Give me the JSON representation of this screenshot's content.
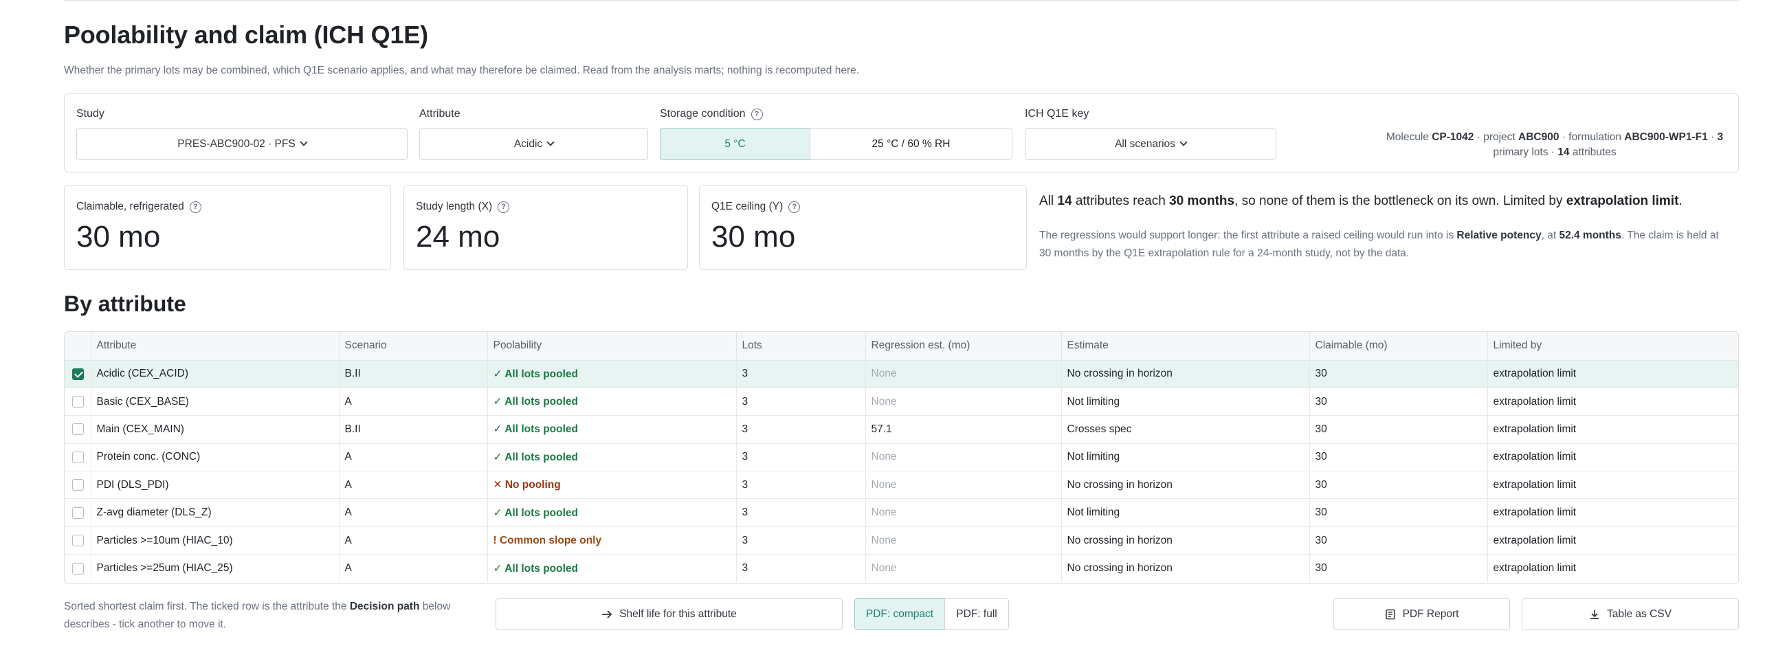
{
  "page": {
    "title": "Poolability and claim (ICH Q1E)",
    "subtitle": "Whether the primary lots may be combined, which Q1E scenario applies, and what may therefore be claimed. Read from the analysis marts; nothing is recomputed here."
  },
  "filters": {
    "study": {
      "label": "Study",
      "value": "PRES-ABC900-02 · PFS"
    },
    "attribute": {
      "label": "Attribute",
      "value": "Acidic"
    },
    "storage": {
      "label": "Storage condition",
      "options": [
        "5 °C",
        "25 °C / 60 % RH"
      ],
      "selected": "5 °C"
    },
    "key": {
      "label": "ICH Q1E key",
      "value": "All scenarios"
    },
    "meta": {
      "prefix1": "Molecule ",
      "molecule": "CP-1042",
      "prefix2": " · project ",
      "project": "ABC900",
      "prefix3": " · formulation ",
      "formulation": "ABC900-WP1-F1",
      "prefix4": " · ",
      "lots": "3",
      "prefix5": " primary lots · ",
      "attributes": "14",
      "suffix": " attributes"
    }
  },
  "metrics": [
    {
      "label": "Claimable, refrigerated",
      "value": "30 mo"
    },
    {
      "label": "Study length (X)",
      "value": "24 mo"
    },
    {
      "label": "Q1E ceiling (Y)",
      "value": "30 mo"
    }
  ],
  "summary": {
    "p1": "All ",
    "count": "14",
    "p2": " attributes reach ",
    "months": "30 months",
    "p3": ", so none of them is the bottleneck on its own. Limited by ",
    "limit": "extrapolation limit",
    "p4": ".",
    "s1": "The regressions would support longer: the first attribute a raised ceiling would run into is ",
    "first_attr": "Relative potency",
    "s2": ", at ",
    "first_months": "52.4 months",
    "s3": ". The claim is held at 30 months by the Q1E extrapolation rule for a 24-month study, not by the data."
  },
  "table": {
    "title": "By attribute",
    "headers": [
      "",
      "Attribute",
      "Scenario",
      "Poolability",
      "Lots",
      "Regression est. (mo)",
      "Estimate",
      "Claimable (mo)",
      "Limited by"
    ],
    "rows": [
      {
        "checked": true,
        "attribute": "Acidic (CEX_ACID)",
        "scenario": "B.II",
        "pool": "✓ All lots pooled",
        "pool_kind": "ok",
        "lots": "3",
        "reg": "None",
        "estimate": "No crossing in horizon",
        "claim": "30",
        "limit": "extrapolation limit"
      },
      {
        "checked": false,
        "attribute": "Basic (CEX_BASE)",
        "scenario": "A",
        "pool": "✓ All lots pooled",
        "pool_kind": "ok",
        "lots": "3",
        "reg": "None",
        "estimate": "Not limiting",
        "claim": "30",
        "limit": "extrapolation limit"
      },
      {
        "checked": false,
        "attribute": "Main (CEX_MAIN)",
        "scenario": "B.II",
        "pool": "✓ All lots pooled",
        "pool_kind": "ok",
        "lots": "3",
        "reg": "57.1",
        "estimate": "Crosses spec",
        "claim": "30",
        "limit": "extrapolation limit"
      },
      {
        "checked": false,
        "attribute": "Protein conc. (CONC)",
        "scenario": "A",
        "pool": "✓ All lots pooled",
        "pool_kind": "ok",
        "lots": "3",
        "reg": "None",
        "estimate": "Not limiting",
        "claim": "30",
        "limit": "extrapolation limit"
      },
      {
        "checked": false,
        "attribute": "PDI (DLS_PDI)",
        "scenario": "A",
        "pool": "✕ No pooling",
        "pool_kind": "no",
        "lots": "3",
        "reg": "None",
        "estimate": "No crossing in horizon",
        "claim": "30",
        "limit": "extrapolation limit"
      },
      {
        "checked": false,
        "attribute": "Z-avg diameter (DLS_Z)",
        "scenario": "A",
        "pool": "✓ All lots pooled",
        "pool_kind": "ok",
        "lots": "3",
        "reg": "None",
        "estimate": "Not limiting",
        "claim": "30",
        "limit": "extrapolation limit"
      },
      {
        "checked": false,
        "attribute": "Particles >=10um (HIAC_10)",
        "scenario": "A",
        "pool": "! Common slope only",
        "pool_kind": "part",
        "lots": "3",
        "reg": "None",
        "estimate": "No crossing in horizon",
        "claim": "30",
        "limit": "extrapolation limit"
      },
      {
        "checked": false,
        "attribute": "Particles >=25um (HIAC_25)",
        "scenario": "A",
        "pool": "✓ All lots pooled",
        "pool_kind": "ok",
        "lots": "3",
        "reg": "None",
        "estimate": "No crossing in horizon",
        "claim": "30",
        "limit": "extrapolation limit"
      }
    ]
  },
  "footer": {
    "note1": "Sorted shortest claim first. The ticked row is the attribute the ",
    "note_bold": "Decision path",
    "note2": " below describes - tick another to move it.",
    "shelf_button": "Shelf life for this attribute",
    "pdf_compact": "PDF: compact",
    "pdf_full": "PDF: full",
    "pdf_report": "PDF Report",
    "csv": "Table as CSV"
  }
}
